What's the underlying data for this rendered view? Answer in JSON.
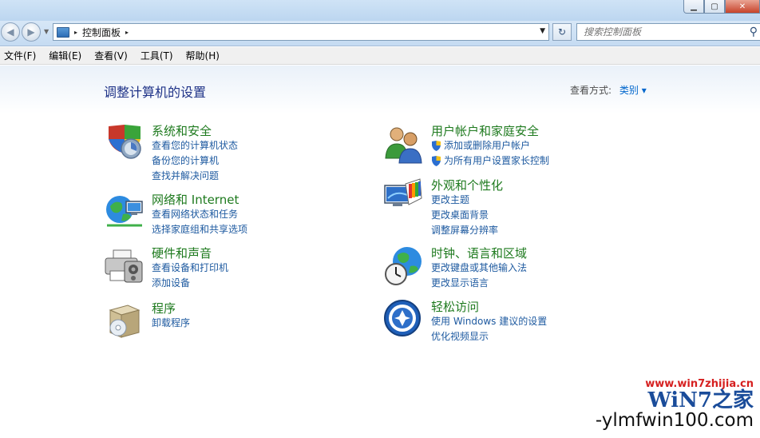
{
  "window": {
    "min_label": "▁",
    "max_label": "▢",
    "close_label": "✕"
  },
  "address": {
    "location": "控制面板",
    "sep": "▸",
    "sep_after": "▸"
  },
  "search": {
    "placeholder": "搜索控制面板"
  },
  "menu": [
    "文件(F)",
    "编辑(E)",
    "查看(V)",
    "工具(T)",
    "帮助(H)"
  ],
  "page": {
    "heading": "调整计算机的设置",
    "view_by_label": "查看方式:",
    "view_by_value": "类别 ▾"
  },
  "categories": [
    {
      "title": "系统和安全",
      "icon": "shield-security-icon",
      "links": [
        "查看您的计算机状态",
        "备份您的计算机",
        "查找并解决问题"
      ]
    },
    {
      "title": "网络和 Internet",
      "icon": "network-globe-icon",
      "links": [
        "查看网络状态和任务",
        "选择家庭组和共享选项"
      ]
    },
    {
      "title": "硬件和声音",
      "icon": "printer-hardware-icon",
      "links": [
        "查看设备和打印机",
        "添加设备"
      ]
    },
    {
      "title": "程序",
      "icon": "programs-box-icon",
      "links": [
        "卸载程序"
      ]
    },
    {
      "title": "用户帐户和家庭安全",
      "icon": "users-icon",
      "links": [
        "添加或删除用户帐户",
        "为所有用户设置家长控制"
      ]
    },
    {
      "title": "外观和个性化",
      "icon": "display-palette-icon",
      "links": [
        "更改主题",
        "更改桌面背景",
        "调整屏幕分辨率"
      ]
    },
    {
      "title": "时钟、语言和区域",
      "icon": "clock-globe-icon",
      "links": [
        "更改键盘或其他输入法",
        "更改显示语言"
      ]
    },
    {
      "title": "轻松访问",
      "icon": "ease-of-access-icon",
      "links": [
        "使用 Windows 建议的设置",
        "优化视频显示"
      ]
    }
  ],
  "watermark": {
    "url": "www.win7zhijia.cn",
    "logo": "WiN7之家",
    "site": "-ylmfwin100.com"
  }
}
